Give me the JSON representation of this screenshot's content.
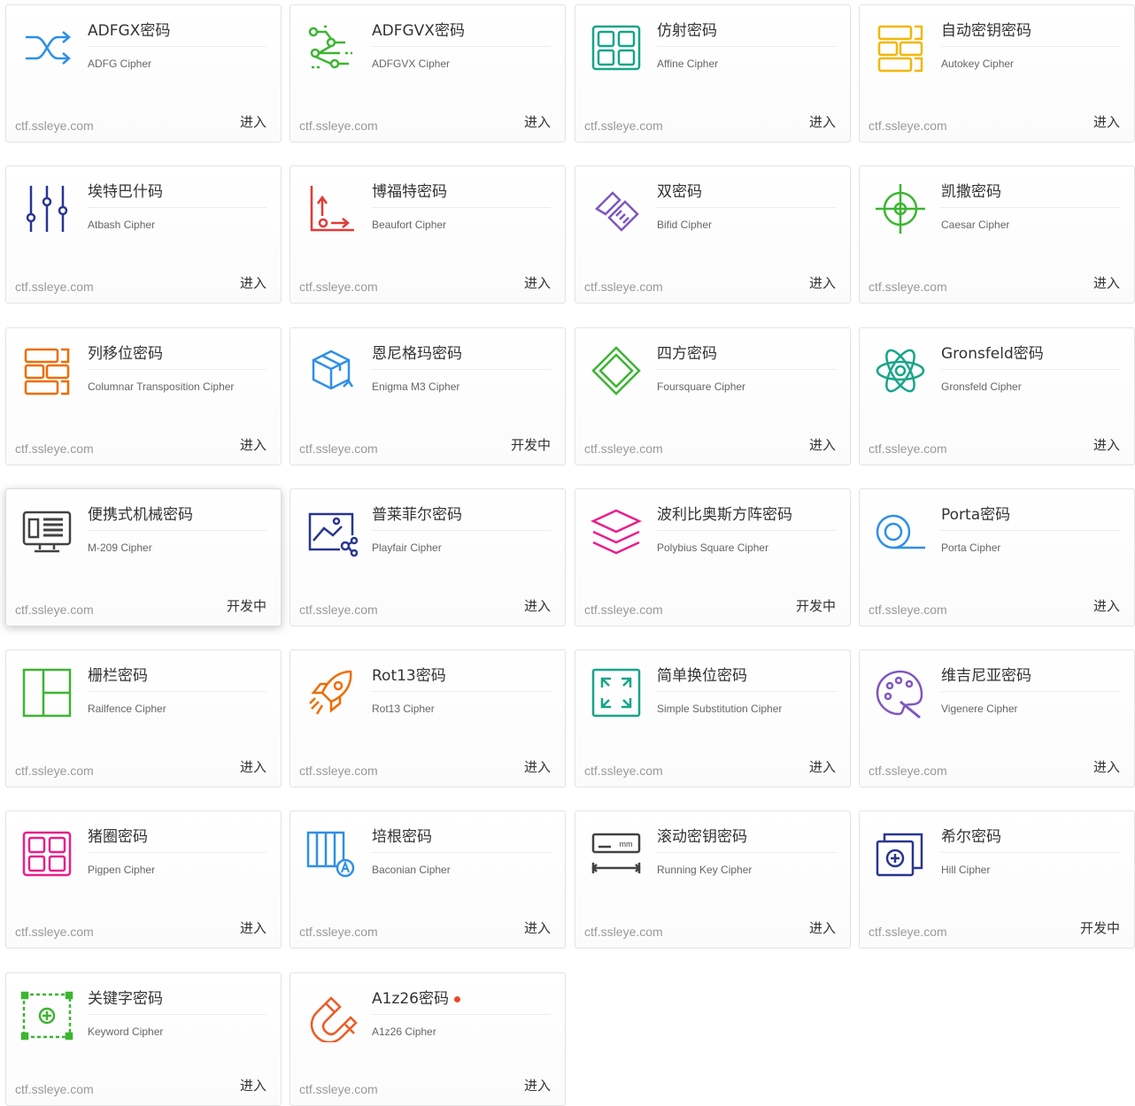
{
  "colors": {
    "blue": "#2e8fe8",
    "green": "#3cb531",
    "teal": "#17a589",
    "yellow": "#f2b705",
    "navy": "#283593",
    "red": "#e53935",
    "purple": "#7e57c2",
    "orange": "#ef6c00",
    "pink": "#e91e8c",
    "darkgray": "#424242"
  },
  "cards": [
    {
      "title": "ADFGX密码",
      "subtitle": "ADFG Cipher",
      "domain": "ctf.ssleye.com",
      "action": "进入",
      "icon": "shuffle-icon",
      "color": "#2e8fe8"
    },
    {
      "title": "ADFGVX密码",
      "subtitle": "ADFGVX Cipher",
      "domain": "ctf.ssleye.com",
      "action": "进入",
      "icon": "circuit-icon",
      "color": "#3cb531"
    },
    {
      "title": "仿射密码",
      "subtitle": "Affine Cipher",
      "domain": "ctf.ssleye.com",
      "action": "进入",
      "icon": "grid-squares-icon",
      "color": "#17a589"
    },
    {
      "title": "自动密钥密码",
      "subtitle": "Autokey Cipher",
      "domain": "ctf.ssleye.com",
      "action": "进入",
      "icon": "bricks-icon",
      "color": "#f2b705"
    },
    {
      "title": "埃特巴什码",
      "subtitle": "Atbash Cipher",
      "domain": "ctf.ssleye.com",
      "action": "进入",
      "icon": "sliders-icon",
      "color": "#283593"
    },
    {
      "title": "博福特密码",
      "subtitle": "Beaufort Cipher",
      "domain": "ctf.ssleye.com",
      "action": "进入",
      "icon": "axis-arrows-icon",
      "color": "#e53935"
    },
    {
      "title": "双密码",
      "subtitle": "Bifid Cipher",
      "domain": "ctf.ssleye.com",
      "action": "进入",
      "icon": "handshake-icon",
      "color": "#7e57c2"
    },
    {
      "title": "凯撒密码",
      "subtitle": "Caesar Cipher",
      "domain": "ctf.ssleye.com",
      "action": "进入",
      "icon": "crosshair-icon",
      "color": "#3cb531"
    },
    {
      "title": "列移位密码",
      "subtitle": "Columnar Transposition Cipher",
      "domain": "ctf.ssleye.com",
      "action": "进入",
      "icon": "bricks-icon",
      "color": "#ef6c00"
    },
    {
      "title": "恩尼格玛密码",
      "subtitle": "Enigma M3 Cipher",
      "domain": "ctf.ssleye.com",
      "action": "开发中",
      "icon": "box-icon",
      "color": "#2e8fe8"
    },
    {
      "title": "四方密码",
      "subtitle": "Foursquare Cipher",
      "domain": "ctf.ssleye.com",
      "action": "进入",
      "icon": "diamond-icon",
      "color": "#3cb531"
    },
    {
      "title": "Gronsfeld密码",
      "subtitle": "Gronsfeld Cipher",
      "domain": "ctf.ssleye.com",
      "action": "进入",
      "icon": "atom-icon",
      "color": "#17a589"
    },
    {
      "title": "便携式机械密码",
      "subtitle": "M-209 Cipher",
      "domain": "ctf.ssleye.com",
      "action": "开发中",
      "icon": "monitor-icon",
      "color": "#424242",
      "hover": true
    },
    {
      "title": "普莱菲尔密码",
      "subtitle": "Playfair Cipher",
      "domain": "ctf.ssleye.com",
      "action": "进入",
      "icon": "image-share-icon",
      "color": "#283593"
    },
    {
      "title": "波利比奥斯方阵密码",
      "subtitle": "Polybius Square Cipher",
      "domain": "ctf.ssleye.com",
      "action": "开发中",
      "icon": "layers-icon",
      "color": "#e91e8c"
    },
    {
      "title": "Porta密码",
      "subtitle": "Porta Cipher",
      "domain": "ctf.ssleye.com",
      "action": "进入",
      "icon": "tape-icon",
      "color": "#2e8fe8"
    },
    {
      "title": "栅栏密码",
      "subtitle": "Railfence Cipher",
      "domain": "ctf.ssleye.com",
      "action": "进入",
      "icon": "layout-icon",
      "color": "#3cb531"
    },
    {
      "title": "Rot13密码",
      "subtitle": "Rot13 Cipher",
      "domain": "ctf.ssleye.com",
      "action": "进入",
      "icon": "rocket-icon",
      "color": "#ef6c00"
    },
    {
      "title": "简单换位密码",
      "subtitle": "Simple Substitution Cipher",
      "domain": "ctf.ssleye.com",
      "action": "进入",
      "icon": "expand-icon",
      "color": "#17a589"
    },
    {
      "title": "维吉尼亚密码",
      "subtitle": "Vigenere Cipher",
      "domain": "ctf.ssleye.com",
      "action": "进入",
      "icon": "palette-icon",
      "color": "#7e57c2"
    },
    {
      "title": "猪圈密码",
      "subtitle": "Pigpen Cipher",
      "domain": "ctf.ssleye.com",
      "action": "进入",
      "icon": "grid-squares-icon",
      "color": "#e91e8c"
    },
    {
      "title": "培根密码",
      "subtitle": "Baconian Cipher",
      "domain": "ctf.ssleye.com",
      "action": "进入",
      "icon": "columns-a-icon",
      "color": "#2e8fe8"
    },
    {
      "title": "滚动密钥密码",
      "subtitle": "Running Key Cipher",
      "domain": "ctf.ssleye.com",
      "action": "进入",
      "icon": "ruler-icon",
      "color": "#424242",
      "icon_text": "mm"
    },
    {
      "title": "希尔密码",
      "subtitle": "Hill Cipher",
      "domain": "ctf.ssleye.com",
      "action": "开发中",
      "icon": "stacked-plus-icon",
      "color": "#283593"
    },
    {
      "title": "关键字密码",
      "subtitle": "Keyword Cipher",
      "domain": "ctf.ssleye.com",
      "action": "进入",
      "icon": "dashed-plus-icon",
      "color": "#3cb531"
    },
    {
      "title": "A1z26密码",
      "subtitle": "A1z26 Cipher",
      "domain": "ctf.ssleye.com",
      "action": "进入",
      "icon": "magnet-icon",
      "color": "#ef5a24",
      "badge": true
    }
  ]
}
